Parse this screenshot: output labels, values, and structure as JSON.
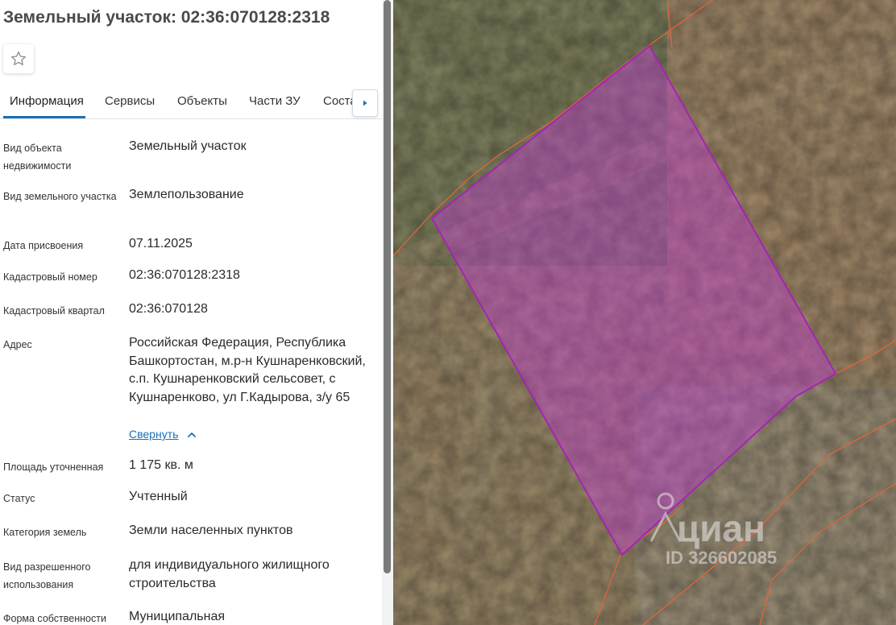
{
  "panel": {
    "title": "Земельный участок: 02:36:070128:2318",
    "favorite_icon": "star-outline-icon",
    "tabs": [
      {
        "label": "Информация",
        "active": true
      },
      {
        "label": "Сервисы"
      },
      {
        "label": "Объекты"
      },
      {
        "label": "Части ЗУ"
      },
      {
        "label": "Соста"
      }
    ],
    "tab_next_icon": "chevron-right-icon",
    "fields": [
      {
        "label": "Вид объекта недвижимости",
        "value": "Земельный участок"
      },
      {
        "label": "Вид земельного участка",
        "value": "Землепользование"
      },
      {
        "label": "Дата присвоения",
        "value": "07.11.2025"
      },
      {
        "label": "Кадастровый номер",
        "value": "02:36:070128:2318"
      },
      {
        "label": "Кадастровый квартал",
        "value": "02:36:070128"
      },
      {
        "label": "Адрес",
        "value": "Российская Федерация, Республика Башкортостан, м.р-н Кушнаренковский, с.п. Кушнаренковский сельсовет, с Кушнаренково, ул Г.Кадырова, з/у 65"
      },
      {
        "label": "Площадь уточненная",
        "value": "1 175 кв. м"
      },
      {
        "label": "Статус",
        "value": "Учтенный"
      },
      {
        "label": "Категория земель",
        "value": "Земли населенных пунктов"
      },
      {
        "label": "Вид разрешенного использования",
        "value": "для индивидуального жилищного строительства"
      },
      {
        "label": "Форма собственности",
        "value": "Муниципальная"
      }
    ],
    "collapse_link": "Свернуть",
    "collapse_icon": "chevron-up-icon"
  },
  "map": {
    "watermark": "циан",
    "watermark_id": "ID 326602085",
    "parcel_color": "#c03ed0",
    "boundary_color": "#e0653c"
  }
}
